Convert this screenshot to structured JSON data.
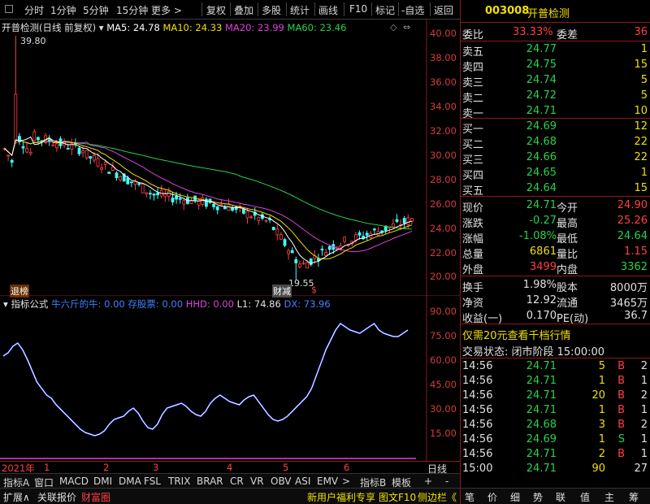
{
  "toolbar": {
    "items": [
      "分时",
      "1分钟",
      "5分钟",
      "15分钟",
      "更多 >",
      "复权",
      "叠加",
      "多股",
      "统计",
      "画线",
      "F10",
      "标记",
      "-自选",
      "返回"
    ]
  },
  "chart": {
    "name": "开普检测(日线 前复权)",
    "ma5": "MA5: 24.78",
    "ma10": "MA10: 24.33",
    "ma20": "MA20: 23.99",
    "ma60": "MA60: 23.46",
    "high_label": "39.80",
    "low_label": "19.55",
    "y_ticks": [
      "40.00",
      "38.00",
      "36.00",
      "34.00",
      "32.00",
      "30.00",
      "28.00",
      "26.00",
      "24.00",
      "22.00",
      "20.00"
    ],
    "markers": [
      "退榜",
      "财减",
      "$"
    ],
    "colors": {
      "ma5": "#ffffff",
      "ma10": "#f0e000",
      "ma20": "#e040e0",
      "ma60": "#28d24a",
      "up": "#ff4040",
      "down": "#40ffff"
    }
  },
  "indicator": {
    "label": "指标公式",
    "i1": "牛六斤的牛: 0.00",
    "i2": "存股票: 0.00",
    "i3": "HHD: 0.00",
    "i4": "L1: 74.86",
    "i5": "DX: 73.96",
    "y_ticks": [
      "90.00",
      "75.00",
      "60.00",
      "45.00",
      "30.00",
      "15.00"
    ]
  },
  "date_axis": {
    "year": "2021年",
    "months": [
      "1",
      "2",
      "3",
      "4",
      "5",
      "6"
    ],
    "period": "日线"
  },
  "tabs": [
    "指标A",
    "窗口",
    "MACD",
    "DMI",
    "DMA",
    "FSL",
    "TRIX",
    "BRAR",
    "CR",
    "VR",
    "OBV",
    "ASI",
    "EMV",
    ">",
    "指标B",
    "模板",
    "+",
    "-"
  ],
  "status": {
    "expand": "扩展∧",
    "related": "关联报价",
    "fortune": "财富圈",
    "news": "新用户福利专享",
    "f10": "图文F10",
    "side": "侧边栏《",
    "icons": [
      "笔",
      "价",
      "细",
      "势",
      "联",
      "值",
      "主",
      "筹"
    ]
  },
  "quote": {
    "code": "003008",
    "name": "开普检测",
    "weibi_label": "委比",
    "weibi": "33.33%",
    "weicha_label": "委差",
    "weicha": "36",
    "asks": [
      {
        "label": "卖五",
        "price": "24.77",
        "vol": "1"
      },
      {
        "label": "卖四",
        "price": "24.75",
        "vol": "15"
      },
      {
        "label": "卖三",
        "price": "24.74",
        "vol": "5"
      },
      {
        "label": "卖二",
        "price": "24.72",
        "vol": "5"
      },
      {
        "label": "卖一",
        "price": "24.71",
        "vol": "10"
      }
    ],
    "bids": [
      {
        "label": "买一",
        "price": "24.69",
        "vol": "12"
      },
      {
        "label": "买二",
        "price": "24.68",
        "vol": "22"
      },
      {
        "label": "买三",
        "price": "24.66",
        "vol": "22"
      },
      {
        "label": "买四",
        "price": "24.65",
        "vol": "1"
      },
      {
        "label": "买五",
        "price": "24.64",
        "vol": "15"
      }
    ],
    "stats": [
      [
        "现价",
        "24.71",
        "今开",
        "24.90"
      ],
      [
        "涨跌",
        "-0.27",
        "最高",
        "25.26"
      ],
      [
        "涨幅",
        "-1.08%",
        "最低",
        "24.64"
      ],
      [
        "总量",
        "6861",
        "量比",
        "1.15"
      ],
      [
        "外盘",
        "3499",
        "内盘",
        "3362"
      ]
    ],
    "stats2": [
      [
        "换手",
        "1.98%",
        "股本",
        "8000万"
      ],
      [
        "净资",
        "12.92",
        "流通",
        "3465万"
      ],
      [
        "收益(一)",
        "0.170",
        "PE(动)",
        "36.7"
      ]
    ],
    "promo": "仅需20元查看千档行情",
    "trade_state": "交易状态: 闭市阶段 15:00:00",
    "ticks": [
      [
        "14:56",
        "24.71",
        "5",
        "B",
        "2"
      ],
      [
        "14:56",
        "24.71",
        "1",
        "B",
        "1"
      ],
      [
        "14:56",
        "24.71",
        "20",
        "B",
        "2"
      ],
      [
        "14:56",
        "24.71",
        "1",
        "B",
        "1"
      ],
      [
        "14:56",
        "24.68",
        "3",
        "B",
        "2"
      ],
      [
        "14:56",
        "24.69",
        "1",
        "S",
        "1"
      ],
      [
        "14:56",
        "24.71",
        "2",
        "B",
        "1"
      ],
      [
        "15:00",
        "24.71",
        "90",
        "",
        "27"
      ]
    ]
  }
}
